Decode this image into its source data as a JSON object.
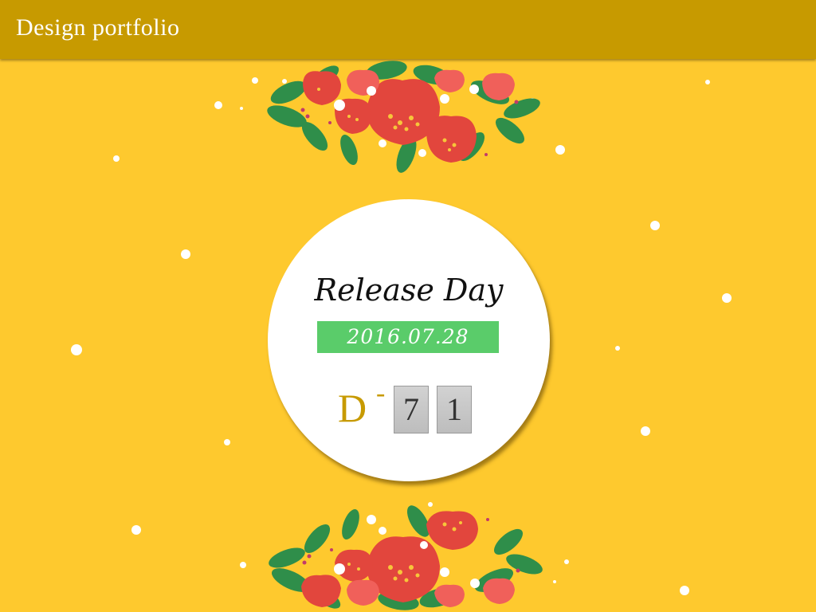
{
  "header": {
    "title": "Design portfolio"
  },
  "release": {
    "title": "Release Day",
    "date": "2016.07.28",
    "d_prefix": "D",
    "d_separator": "-",
    "digits": [
      "7",
      "1"
    ]
  },
  "colors": {
    "background": "#FEC92E",
    "header": "#C79A00",
    "date_bar": "#5ACC6A",
    "accent": "#C79A00"
  },
  "decor": {
    "flowers_icon": "flower-bouquet-icon",
    "sparkle_icon": "dot-icon"
  }
}
